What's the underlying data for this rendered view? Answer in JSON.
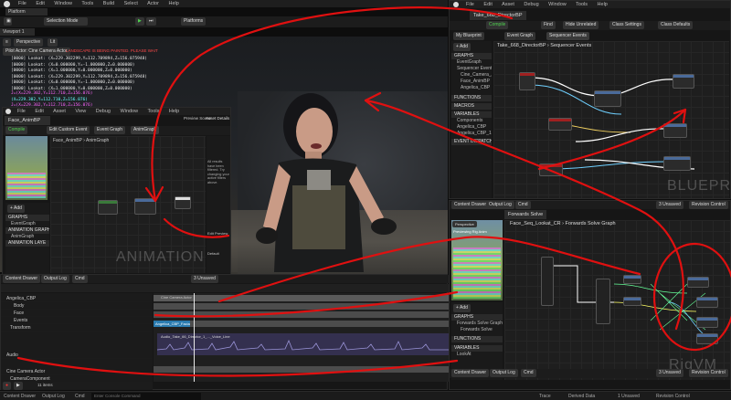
{
  "main_editor": {
    "menu": [
      "File",
      "Edit",
      "Window",
      "Tools",
      "Build",
      "Select",
      "Actor",
      "Help"
    ],
    "level_tab": "Platform",
    "mode": "Selection Mode",
    "platforms_label": "Platforms"
  },
  "viewport": {
    "tab": "Viewport 1",
    "perspective": "Perspective",
    "lit": "Lit",
    "camera_label": "Pilot Actor: Cine Camera Actor",
    "warning": "LANDSCAPE IS BEING PAINTED. PLEASE WAIT",
    "debug_white": [
      "[0000] Lookat: (X=229.302299,Y=112.709894,Z=156.075948)",
      "[0000] Lookat: (X=0.000000,Y=-1.000000,Z=0.000000)",
      "[0000] Lookat: (X=1.000000,Y=0.000000,Z=0.000000)",
      "[0000] Lookat: (X=229.302299,Y=112.709894,Z=156.075948)",
      "[0000] Lookat: (X=0.000000,Y=-1.000000,Z=0.000000)",
      "[0000] Lookat: (X=1.000000,Y=0.000000,Z=0.000000)"
    ],
    "debug_color": [
      "J=(X=229.302,Y=112.710,Z=156.076)",
      "(X=229.302,Y=112.710,Z=156.076)",
      "J=(X=229.302,Y=112.710,Z=156.076)",
      "(X=229.302,Y=112.710,Z=156.076)"
    ]
  },
  "sequencer_bp": {
    "menu": [
      "File",
      "Edit",
      "Asset",
      "Debug",
      "Window",
      "Tools",
      "Help"
    ],
    "asset_tab": "Take_668_DirectorBP",
    "toolbar": [
      "Compile",
      "Find",
      "Hide Unrelated",
      "Class Settings",
      "Class Defaults"
    ],
    "tabs": [
      "My Blueprint",
      "Event Graph",
      "Sequencer Events"
    ],
    "breadcrumb": [
      "Take_668_DirectorBP",
      "Sequencer Events"
    ],
    "sidebar_items": [
      "GRAPHS",
      "EventGraph",
      "Sequencer Events",
      "Cine_Camera_Ac",
      "Face_AnimBP",
      "Angelica_CBP",
      "FUNCTIONS",
      "MACROS",
      "VARIABLES",
      "Components",
      "Angelica_CBP",
      "Angelica_CBP_1",
      "EVENT DISPATCHERS"
    ],
    "add_label": "+ Add",
    "watermark": "BLUEPRINT"
  },
  "anim_bp": {
    "menu": [
      "File",
      "Edit",
      "Asset",
      "View",
      "Debug",
      "Window",
      "Tools",
      "Help"
    ],
    "asset_tab": "Face_AnimBP",
    "toolbar": [
      "Compile",
      "Edit Custom Event",
      "Event Graph",
      "AnimGraph"
    ],
    "preview_label": "Preview Scene",
    "preview_tab": "Asset Details",
    "breadcrumb": [
      "Face_AnimBP",
      "AnimGraph"
    ],
    "sidebar_items": [
      "GRAPHS",
      "EventGraph",
      "ANIMATION GRAPHS",
      "AnimGraph",
      "ANIMATION LAYE"
    ],
    "add_label": "+ Add",
    "watermark": "ANIMATION",
    "preview_text": "All results have been filtered. Try changing your active filters above.",
    "edit_preview": "Edit Preview",
    "default_label": "Default"
  },
  "sequencer": {
    "tabs": [
      "Content Drawer",
      "Output Log",
      "Cmd"
    ],
    "unsaved": "3 Unsaved",
    "tracks": [
      "Angelica_CBP",
      "Body",
      "Face",
      "Events",
      "Transform",
      "Audio",
      "Cine Camera Actor",
      "CameraComponent"
    ],
    "audio_clip": "Audio_Take_66_Director_1_..._Voice_Line",
    "sub_clip": "Angelica_CBP_Facial",
    "camera_clip": "Cine Camera Actor",
    "items_count": "11 items"
  },
  "control_rig": {
    "content_tabs": [
      "Content Drawer",
      "Output Log",
      "Cmd"
    ],
    "rig_tab": "Forwards Solve",
    "breadcrumb": [
      "Face_Seq_Lookat_CR",
      "Forwards Solve Graph"
    ],
    "viewport": "Perspective",
    "previewing": "Previewing Rig Anim",
    "sidebar_items": [
      "GRAPHS",
      "Forwards Solve Graph",
      "Forwards Solve",
      "FUNCTIONS",
      "VARIABLES",
      "LookAt"
    ],
    "add_label": "+ Add",
    "watermark": "RigVM",
    "unsaved": "3 Unsaved",
    "revision": "Revision Control",
    "search_placeholder": "Search Graph"
  },
  "statusbar": {
    "left": [
      "Content Drawer",
      "Output Log",
      "Cmd"
    ],
    "right": [
      "Trace",
      "Derived Data",
      "1 Unsaved",
      "Revision Control"
    ],
    "cmd_placeholder": "Enter Console Command"
  },
  "colors": {
    "annotation": "#e01010",
    "compile_green": "#4fd04f",
    "bg": "#0d0d0d"
  }
}
